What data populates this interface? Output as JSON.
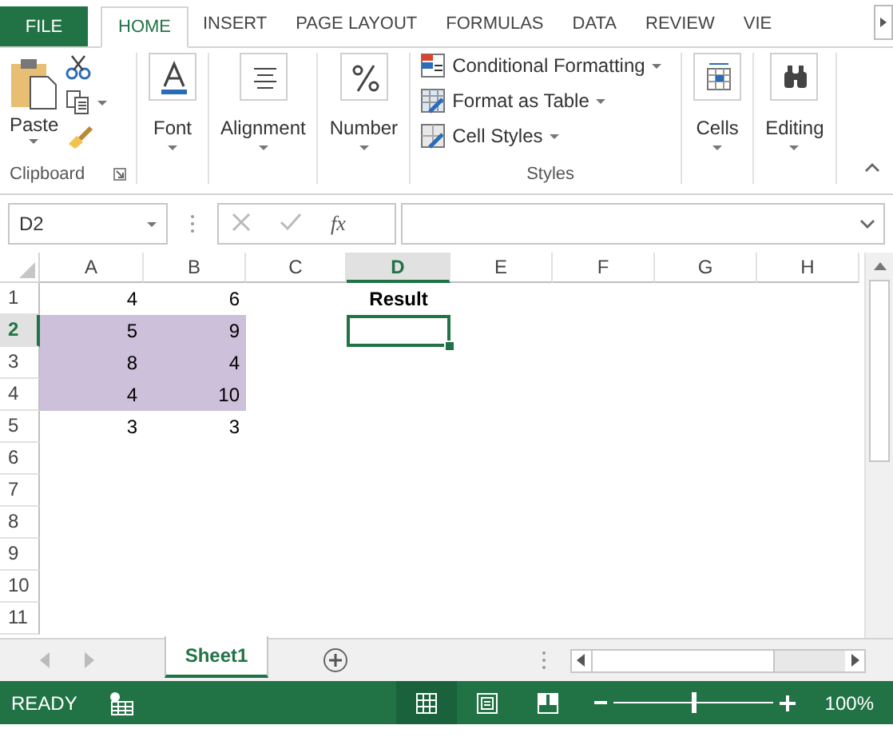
{
  "ribbon_tabs": [
    {
      "label": "FILE",
      "kind": "file",
      "selected": false
    },
    {
      "label": "HOME",
      "kind": "tab",
      "selected": true
    },
    {
      "label": "INSERT",
      "kind": "tab",
      "selected": false
    },
    {
      "label": "PAGE LAYOUT",
      "kind": "tab",
      "selected": false
    },
    {
      "label": "FORMULAS",
      "kind": "tab",
      "selected": false
    },
    {
      "label": "DATA",
      "kind": "tab",
      "selected": false
    },
    {
      "label": "REVIEW",
      "kind": "tab",
      "selected": false
    },
    {
      "label": "VIE",
      "kind": "tab",
      "selected": false
    }
  ],
  "ribbon": {
    "clipboard": {
      "paste_label": "Paste",
      "caption": "Clipboard"
    },
    "groups": [
      {
        "label": "Font",
        "kind": "font"
      },
      {
        "label": "Alignment",
        "kind": "alignment"
      },
      {
        "label": "Number",
        "kind": "number"
      }
    ],
    "styles": {
      "items": [
        {
          "label": "Conditional Formatting",
          "kind": "conditional"
        },
        {
          "label": "Format as Table",
          "kind": "table"
        },
        {
          "label": "Cell Styles",
          "kind": "cellstyles"
        }
      ],
      "caption": "Styles"
    },
    "right_groups": [
      {
        "label": "Cells",
        "kind": "cells"
      },
      {
        "label": "Editing",
        "kind": "editing"
      }
    ]
  },
  "formula_bar": {
    "name_box": "D2",
    "function_label": "fx"
  },
  "sheet": {
    "columns": [
      {
        "label": "A",
        "selected": false
      },
      {
        "label": "B",
        "selected": false
      },
      {
        "label": "C",
        "selected": false
      },
      {
        "label": "D",
        "selected": true
      },
      {
        "label": "E",
        "selected": false
      },
      {
        "label": "F",
        "selected": false
      },
      {
        "label": "G",
        "selected": false
      },
      {
        "label": "H",
        "selected": false
      }
    ],
    "rows": [
      {
        "header": "1",
        "selected": false,
        "cells": [
          {
            "value": "4",
            "bold": false,
            "highlighted": false,
            "selected": false
          },
          {
            "value": "6",
            "bold": false,
            "highlighted": false,
            "selected": false
          },
          null,
          {
            "value": "Result",
            "bold": true,
            "centered": true,
            "highlighted": false,
            "selected": false
          }
        ]
      },
      {
        "header": "2",
        "selected": true,
        "cells": [
          {
            "value": "5",
            "bold": false,
            "highlighted": true,
            "selected": false
          },
          {
            "value": "9",
            "bold": false,
            "highlighted": true,
            "selected": false
          },
          null,
          {
            "highlighted": false,
            "selected": true
          }
        ]
      },
      {
        "header": "3",
        "selected": false,
        "cells": [
          {
            "value": "8",
            "bold": false,
            "highlighted": true,
            "selected": false
          },
          {
            "value": "4",
            "bold": false,
            "highlighted": true,
            "selected": false
          }
        ]
      },
      {
        "header": "4",
        "selected": false,
        "cells": [
          {
            "value": "4",
            "bold": false,
            "highlighted": true,
            "selected": false
          },
          {
            "value": "10",
            "bold": false,
            "highlighted": true,
            "selected": false
          }
        ]
      },
      {
        "header": "5",
        "selected": false,
        "cells": [
          {
            "value": "3",
            "bold": false,
            "highlighted": false,
            "selected": false
          },
          {
            "value": "3",
            "bold": false,
            "highlighted": false,
            "selected": false
          }
        ]
      },
      {
        "header": "6",
        "selected": false,
        "cells": []
      },
      {
        "header": "7",
        "selected": false,
        "cells": []
      },
      {
        "header": "8",
        "selected": false,
        "cells": []
      },
      {
        "header": "9",
        "selected": false,
        "cells": []
      },
      {
        "header": "10",
        "selected": false,
        "cells": []
      },
      {
        "header": "11",
        "selected": false,
        "cells": []
      }
    ]
  },
  "sheet_tabs": [
    {
      "label": "Sheet1",
      "selected": true
    }
  ],
  "status_bar": {
    "status": "READY",
    "views": [
      {
        "kind": "normal",
        "selected": true
      },
      {
        "kind": "layout",
        "selected": false
      },
      {
        "kind": "break",
        "selected": false
      }
    ],
    "zoom": {
      "level": 0.5,
      "reading": "100%"
    }
  }
}
